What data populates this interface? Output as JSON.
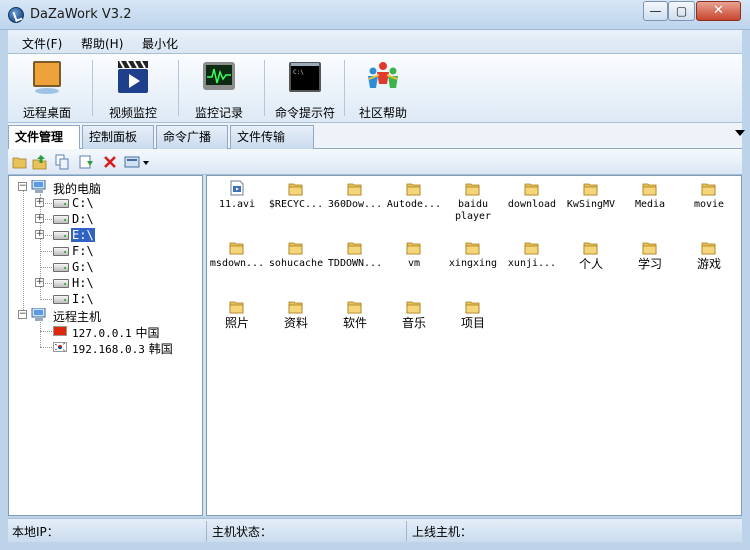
{
  "window": {
    "title": "DaZaWork V3.2"
  },
  "menu": [
    {
      "label": "文件(F)"
    },
    {
      "label": "帮助(H)"
    },
    {
      "label": "最小化"
    }
  ],
  "toolbar": [
    {
      "label": "远程桌面",
      "icon": "remote-desktop-icon"
    },
    {
      "label": "视频监控",
      "icon": "video-camera-icon"
    },
    {
      "label": "监控记录",
      "icon": "monitor-log-icon"
    },
    {
      "label": "命令提示符",
      "icon": "command-prompt-icon"
    },
    {
      "label": "社区帮助",
      "icon": "community-people-icon"
    }
  ],
  "tabs": [
    {
      "label": "文件管理",
      "active": true
    },
    {
      "label": "控制面板"
    },
    {
      "label": "命令广播"
    },
    {
      "label": "文件传输"
    }
  ],
  "tree": {
    "my_computer": "我的电脑",
    "drives": [
      "C:\\",
      "D:\\",
      "E:\\",
      "F:\\",
      "G:\\",
      "H:\\",
      "I:\\"
    ],
    "selected_drive": "E:\\",
    "remote_host": "远程主机",
    "hosts": [
      {
        "ip": "127.0.0.1",
        "country": "中国"
      },
      {
        "ip": "192.168.0.3",
        "country": "韩国"
      }
    ]
  },
  "files": [
    "11.avi",
    "$RECYC...",
    "360Dow...",
    "Autode...",
    "baidu player",
    "download",
    "KwSingMV",
    "Media",
    "movie",
    "msdown...",
    "sohucache",
    "TDDOWN...",
    "vm",
    "xingxing",
    "xunji...",
    "个人",
    "学习",
    "游戏",
    "照片",
    "资料",
    "软件",
    "音乐",
    "项目"
  ],
  "status": {
    "local_ip": "本地IP：",
    "host_status": "主机状态：",
    "online_host": "上线主机："
  },
  "colors": {
    "selection": "#3163c5",
    "folder": "#e8c25a",
    "china_flag": "#de2910"
  }
}
